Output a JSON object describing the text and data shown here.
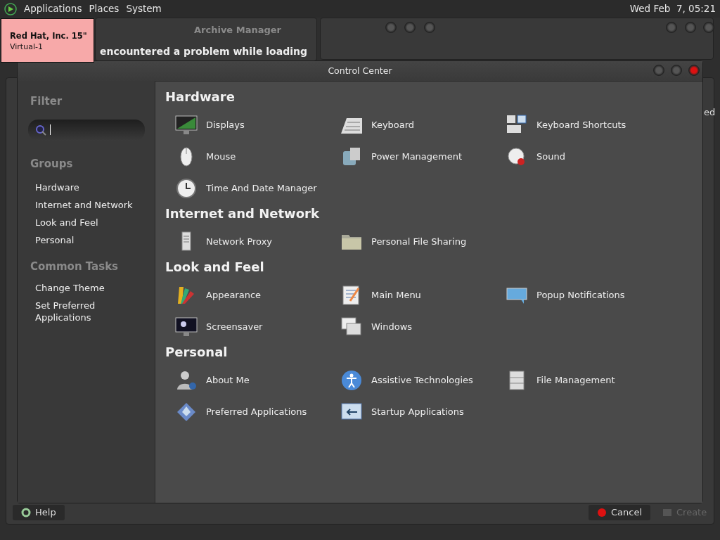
{
  "top_panel": {
    "menus": [
      "Applications",
      "Places",
      "System"
    ],
    "clock": "Wed Feb  7, 05:21"
  },
  "tooltip": {
    "title": "Red Hat, Inc. 15\"",
    "subtitle": "Virtual-1"
  },
  "background_windows": {
    "archive_title": "Archive Manager",
    "message": "encountered a problem while loading",
    "right_fragment": "ed",
    "help_button": "Help",
    "cancel_button": "Cancel",
    "create_button": {
      "label": "Create",
      "disabled": true
    }
  },
  "window": {
    "title": "Control Center"
  },
  "sidebar": {
    "filter_heading": "Filter",
    "groups_heading": "Groups",
    "groups": [
      "Hardware",
      "Internet and Network",
      "Look and Feel",
      "Personal"
    ],
    "tasks_heading": "Common Tasks",
    "tasks": [
      "Change Theme",
      "Set Preferred Applications"
    ]
  },
  "sections": [
    {
      "title": "Hardware",
      "items": [
        "Displays",
        "Keyboard",
        "Keyboard Shortcuts",
        "Mouse",
        "Power Management",
        "Sound",
        "Time And Date Manager"
      ]
    },
    {
      "title": "Internet and Network",
      "items": [
        "Network Proxy",
        "Personal File Sharing"
      ]
    },
    {
      "title": "Look and Feel",
      "items": [
        "Appearance",
        "Main Menu",
        "Popup Notifications",
        "Screensaver",
        "Windows"
      ]
    },
    {
      "title": "Personal",
      "items": [
        "About Me",
        "Assistive Technologies",
        "File Management",
        "Preferred Applications",
        "Startup Applications"
      ]
    }
  ]
}
